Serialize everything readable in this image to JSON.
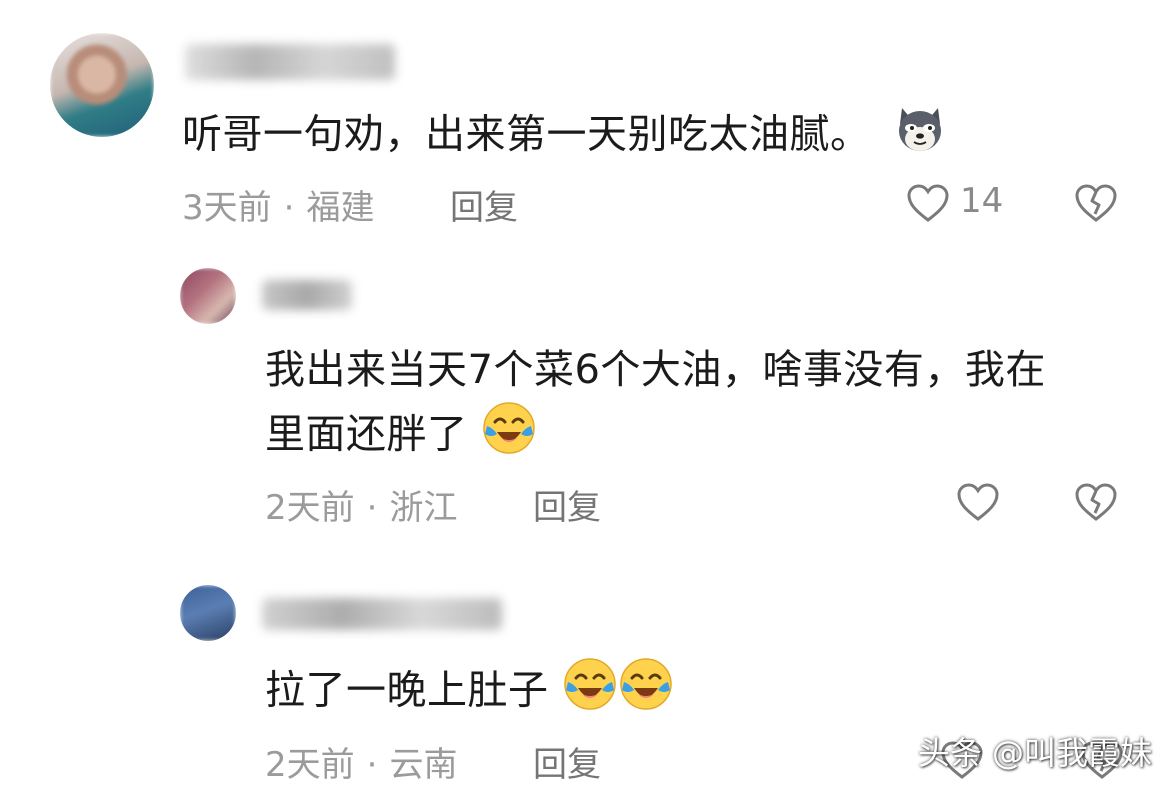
{
  "comments": [
    {
      "text": "听哥一句劝，出来第一天别吃太油腻。",
      "time": "3天前",
      "location": "福建",
      "reply_label": "回复",
      "like_count": "14"
    },
    {
      "text_line1": "我出来当天7个菜6个大油，啥事没有，我在",
      "text_line2": "里面还胖了",
      "time": "2天前",
      "location": "浙江",
      "reply_label": "回复"
    },
    {
      "text": "拉了一晚上肚子",
      "time": "2天前",
      "location": "云南",
      "reply_label": "回复"
    }
  ],
  "separator": "·",
  "watermark": "头条 @叫我霞妹",
  "colors": {
    "meta_gray": "#9b9b9b",
    "icon_gray": "#7a7a7a",
    "emoji_yellow": "#ffd24d",
    "tear_blue": "#3aa0e6"
  }
}
